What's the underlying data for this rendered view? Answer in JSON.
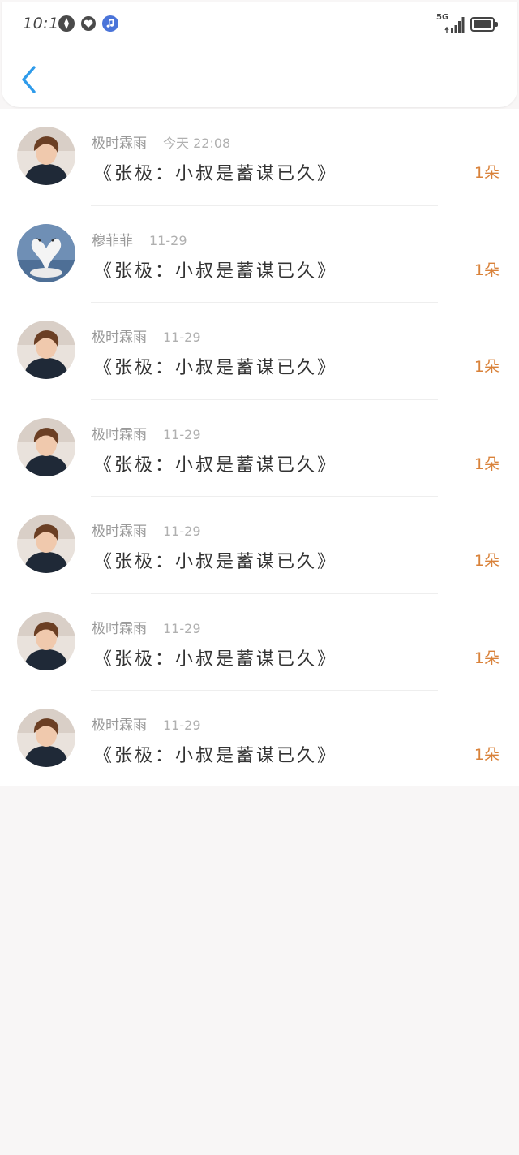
{
  "status_bar": {
    "time": "10:15",
    "network": "5G",
    "icons": [
      "nav-app-icon",
      "heart-icon",
      "music-icon",
      "signal-icon",
      "battery-icon"
    ]
  },
  "nav": {
    "back_icon": "chevron-left-icon",
    "accent_color": "#2f9bea"
  },
  "list": {
    "items": [
      {
        "user": "极时霖雨",
        "date": "今天 22:08",
        "title": "《张极：小叔是蓄谋已久》",
        "count": "1朵",
        "avatar": "person-photo"
      },
      {
        "user": "穆菲菲",
        "date": "11-29",
        "title": "《张极：小叔是蓄谋已久》",
        "count": "1朵",
        "avatar": "swan-photo"
      },
      {
        "user": "极时霖雨",
        "date": "11-29",
        "title": "《张极：小叔是蓄谋已久》",
        "count": "1朵",
        "avatar": "person-photo"
      },
      {
        "user": "极时霖雨",
        "date": "11-29",
        "title": "《张极：小叔是蓄谋已久》",
        "count": "1朵",
        "avatar": "person-photo"
      },
      {
        "user": "极时霖雨",
        "date": "11-29",
        "title": "《张极：小叔是蓄谋已久》",
        "count": "1朵",
        "avatar": "person-photo"
      },
      {
        "user": "极时霖雨",
        "date": "11-29",
        "title": "《张极：小叔是蓄谋已久》",
        "count": "1朵",
        "avatar": "person-photo"
      },
      {
        "user": "极时霖雨",
        "date": "11-29",
        "title": "《张极：小叔是蓄谋已久》",
        "count": "1朵",
        "avatar": "person-photo"
      }
    ]
  },
  "colors": {
    "count": "#d9823a",
    "background": "#f8f6f6"
  }
}
